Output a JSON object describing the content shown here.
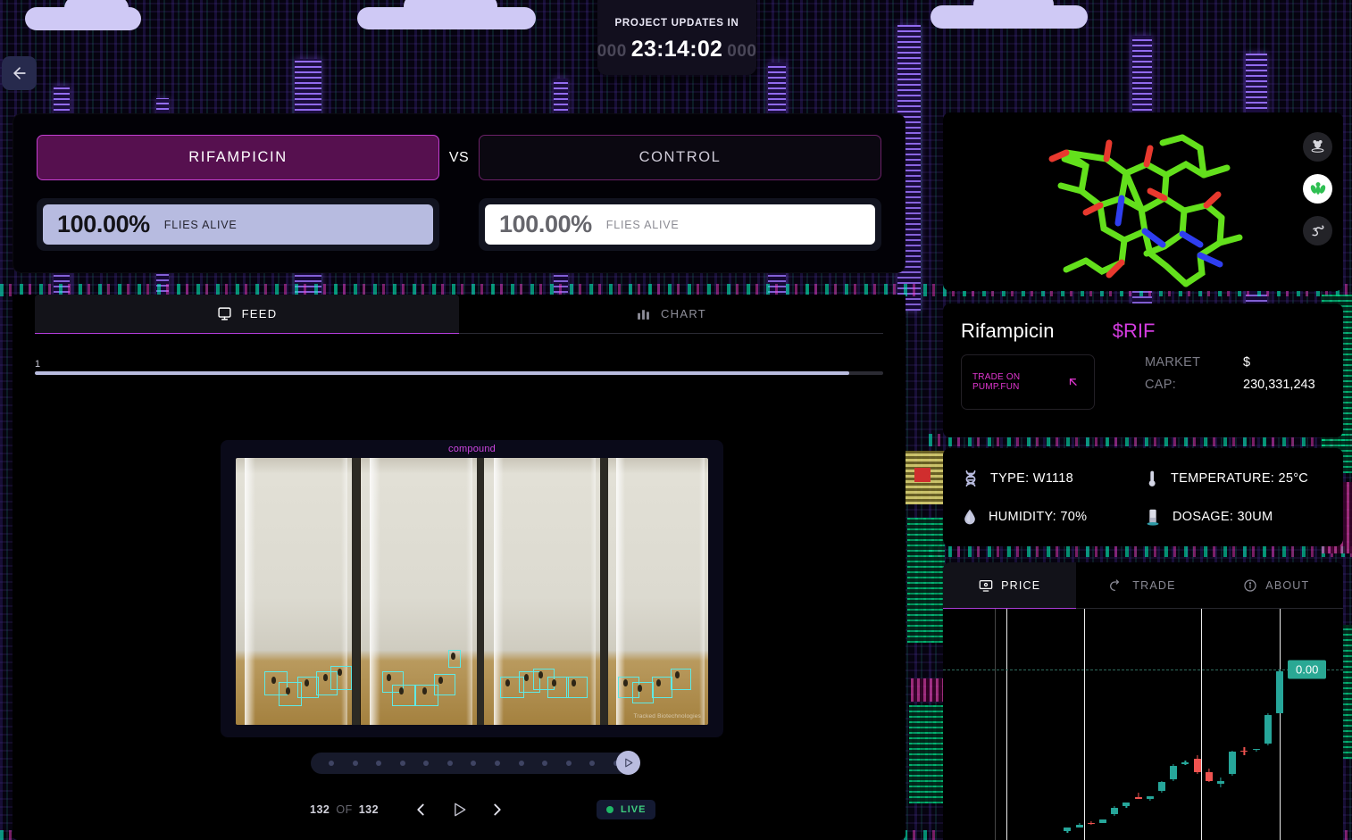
{
  "countdown": {
    "label": "PROJECT UPDATES IN",
    "prefix": "000",
    "time": "23:14:02",
    "suffix": "000"
  },
  "nav": {
    "back_icon": "arrow-left-icon"
  },
  "comparison": {
    "treatment": {
      "name": "RIFAMPICIN",
      "percent": "100.00%",
      "stat_label": "FLIES ALIVE"
    },
    "vs": "VS",
    "control": {
      "name": "CONTROL",
      "percent": "100.00%",
      "stat_label": "FLIES ALIVE"
    }
  },
  "feed": {
    "tabs": [
      {
        "label": "FEED",
        "icon": "monitor-icon",
        "active": true
      },
      {
        "label": "CHART",
        "icon": "bar-chart-icon",
        "active": false
      }
    ],
    "progress_label": "1",
    "progress_percent": 96,
    "video_title": "compound",
    "watermark": "Tracked Biotechnologies",
    "carousel_dots": 13,
    "frame_current": "132",
    "frame_of": "OF",
    "frame_total": "132",
    "controls": {
      "prev": "chevron-left-icon",
      "play": "play-icon",
      "next": "chevron-right-icon"
    },
    "live": "LIVE"
  },
  "molecule": {
    "alt": "rifampicin-3d-model",
    "organisms": [
      {
        "name": "mouse-icon",
        "selected": false
      },
      {
        "name": "fly-icon",
        "selected": true
      },
      {
        "name": "worm-icon",
        "selected": false
      }
    ]
  },
  "token": {
    "name": "Rifampicin",
    "ticker": "$RIF",
    "trade_cta": "TRADE ON PUMP.FUN",
    "trade_icon": "arrow-up-left-icon",
    "market_cap_label_line1": "MARKET",
    "market_cap_label_line2": "CAP:",
    "market_cap_currency": "$",
    "market_cap_value": "230,331,243"
  },
  "specs": [
    {
      "icon": "dna-icon",
      "label": "TYPE:",
      "value": "W1118"
    },
    {
      "icon": "thermometer-icon",
      "label": "TEMPERATURE:",
      "value": "25°C"
    },
    {
      "icon": "droplet-icon",
      "label": "HUMIDITY:",
      "value": "70%"
    },
    {
      "icon": "vial-icon",
      "label": "DOSAGE:",
      "value": "30UM"
    }
  ],
  "price_panel": {
    "tabs": [
      {
        "label": "PRICE",
        "icon": "monitor-price-icon",
        "active": true
      },
      {
        "label": "TRADE",
        "icon": "trade-arrow-icon",
        "active": false
      },
      {
        "label": "ABOUT",
        "icon": "info-icon",
        "active": false
      }
    ]
  },
  "colors": {
    "accent_magenta": "#c23fd0",
    "accent_pink": "#e136d0",
    "lavender": "#b9bcdf",
    "candle_up": "#26a69a",
    "candle_down": "#ef5350",
    "live_green": "#3fcf7f"
  },
  "chart_data": {
    "type": "candlestick",
    "title": "",
    "xlabel": "",
    "ylabel": "",
    "price_label": "0.00",
    "grid": {
      "vertical_lines": 3,
      "horizontal_dashed": 1
    },
    "ohlc": [
      {
        "o": 0.02,
        "h": 0.04,
        "l": 0.01,
        "c": 0.04,
        "dir": "up"
      },
      {
        "o": 0.04,
        "h": 0.07,
        "l": 0.04,
        "c": 0.06,
        "dir": "up"
      },
      {
        "o": 0.07,
        "h": 0.08,
        "l": 0.06,
        "c": 0.07,
        "dir": "down"
      },
      {
        "o": 0.07,
        "h": 0.09,
        "l": 0.07,
        "c": 0.09,
        "dir": "up"
      },
      {
        "o": 0.12,
        "h": 0.17,
        "l": 0.11,
        "c": 0.16,
        "dir": "up"
      },
      {
        "o": 0.17,
        "h": 0.19,
        "l": 0.16,
        "c": 0.19,
        "dir": "up"
      },
      {
        "o": 0.22,
        "h": 0.25,
        "l": 0.21,
        "c": 0.21,
        "dir": "down"
      },
      {
        "o": 0.21,
        "h": 0.23,
        "l": 0.2,
        "c": 0.23,
        "dir": "up"
      },
      {
        "o": 0.26,
        "h": 0.32,
        "l": 0.25,
        "c": 0.31,
        "dir": "up"
      },
      {
        "o": 0.33,
        "h": 0.42,
        "l": 0.32,
        "c": 0.41,
        "dir": "up"
      },
      {
        "o": 0.42,
        "h": 0.44,
        "l": 0.41,
        "c": 0.43,
        "dir": "up"
      },
      {
        "o": 0.45,
        "h": 0.47,
        "l": 0.36,
        "c": 0.37,
        "dir": "down"
      },
      {
        "o": 0.37,
        "h": 0.39,
        "l": 0.31,
        "c": 0.32,
        "dir": "down"
      },
      {
        "o": 0.32,
        "h": 0.34,
        "l": 0.28,
        "c": 0.3,
        "dir": "up"
      },
      {
        "o": 0.36,
        "h": 0.5,
        "l": 0.35,
        "c": 0.49,
        "dir": "up"
      },
      {
        "o": 0.49,
        "h": 0.52,
        "l": 0.47,
        "c": 0.5,
        "dir": "down"
      },
      {
        "o": 0.5,
        "h": 0.51,
        "l": 0.49,
        "c": 0.51,
        "dir": "up"
      },
      {
        "o": 0.54,
        "h": 0.72,
        "l": 0.53,
        "c": 0.71,
        "dir": "up"
      },
      {
        "o": 0.72,
        "h": 0.98,
        "l": 0.72,
        "c": 0.97,
        "dir": "up"
      }
    ],
    "ylim": [
      0,
      1
    ]
  }
}
